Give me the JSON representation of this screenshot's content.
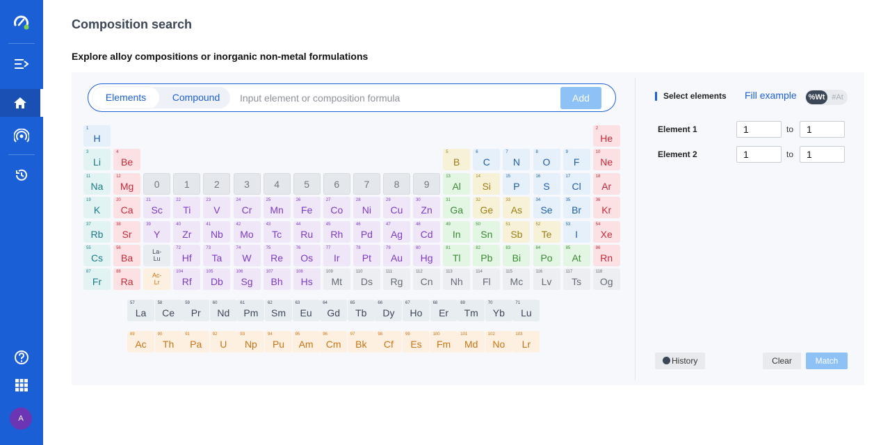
{
  "sidebar": {
    "items": [
      {
        "name": "logo",
        "icon": "speedometer-logo-icon"
      },
      {
        "name": "collapse-menu",
        "icon": "collapse-menu-icon"
      },
      {
        "name": "home",
        "icon": "home-icon",
        "active": true
      },
      {
        "name": "broadcast",
        "icon": "broadcast-icon"
      },
      {
        "name": "history",
        "icon": "history-clock-icon"
      },
      {
        "name": "help",
        "icon": "help-icon"
      },
      {
        "name": "apps",
        "icon": "apps-grid-icon"
      }
    ],
    "avatar": "A"
  },
  "page": {
    "title": "Composition search",
    "subtitle": "Explore alloy compositions or inorganic non-metal formulations"
  },
  "search": {
    "mode_elements": "Elements",
    "mode_compound": "Compound",
    "placeholder": "Input element or composition formula",
    "add_label": "Add"
  },
  "periodic_table": {
    "group_colors": {
      "nonmetal": {
        "bg": "#e6f0fa",
        "fg": "#1b5fa8"
      },
      "noble": {
        "bg": "#fbe1e3",
        "fg": "#c4293a"
      },
      "alkali": {
        "bg": "#e1f3f3",
        "fg": "#1c7a85"
      },
      "alkaline": {
        "bg": "#fbe1e3",
        "fg": "#c4293a"
      },
      "transition": {
        "bg": "#efe6f8",
        "fg": "#7b3bc2"
      },
      "post": {
        "bg": "#e3f5e3",
        "fg": "#3a8a34"
      },
      "metalloid": {
        "bg": "#f7f1d8",
        "fg": "#9b7d13"
      },
      "unknown": {
        "bg": "#eceef1",
        "fg": "#646a75"
      },
      "lanthanide": {
        "bg": "#e8edf2",
        "fg": "#3b4656"
      },
      "actinide": {
        "bg": "#fdf0e0",
        "fg": "#c97416"
      }
    },
    "elements": [
      {
        "n": "1",
        "s": "H",
        "r": 1,
        "c": 1,
        "g": "nonmetal"
      },
      {
        "n": "2",
        "s": "He",
        "r": 1,
        "c": 18,
        "g": "noble"
      },
      {
        "n": "3",
        "s": "Li",
        "r": 2,
        "c": 1,
        "g": "alkali"
      },
      {
        "n": "4",
        "s": "Be",
        "r": 2,
        "c": 2,
        "g": "alkaline"
      },
      {
        "n": "5",
        "s": "B",
        "r": 2,
        "c": 13,
        "g": "metalloid"
      },
      {
        "n": "6",
        "s": "C",
        "r": 2,
        "c": 14,
        "g": "nonmetal"
      },
      {
        "n": "7",
        "s": "N",
        "r": 2,
        "c": 15,
        "g": "nonmetal"
      },
      {
        "n": "8",
        "s": "O",
        "r": 2,
        "c": 16,
        "g": "nonmetal"
      },
      {
        "n": "9",
        "s": "F",
        "r": 2,
        "c": 17,
        "g": "nonmetal"
      },
      {
        "n": "10",
        "s": "Ne",
        "r": 2,
        "c": 18,
        "g": "noble"
      },
      {
        "n": "11",
        "s": "Na",
        "r": 3,
        "c": 1,
        "g": "alkali"
      },
      {
        "n": "12",
        "s": "Mg",
        "r": 3,
        "c": 2,
        "g": "alkaline"
      },
      {
        "n": "13",
        "s": "Al",
        "r": 3,
        "c": 13,
        "g": "post"
      },
      {
        "n": "14",
        "s": "Si",
        "r": 3,
        "c": 14,
        "g": "metalloid"
      },
      {
        "n": "15",
        "s": "P",
        "r": 3,
        "c": 15,
        "g": "nonmetal"
      },
      {
        "n": "16",
        "s": "S",
        "r": 3,
        "c": 16,
        "g": "nonmetal"
      },
      {
        "n": "17",
        "s": "Cl",
        "r": 3,
        "c": 17,
        "g": "nonmetal"
      },
      {
        "n": "18",
        "s": "Ar",
        "r": 3,
        "c": 18,
        "g": "noble"
      },
      {
        "n": "19",
        "s": "K",
        "r": 4,
        "c": 1,
        "g": "alkali"
      },
      {
        "n": "20",
        "s": "Ca",
        "r": 4,
        "c": 2,
        "g": "alkaline"
      },
      {
        "n": "21",
        "s": "Sc",
        "r": 4,
        "c": 3,
        "g": "transition"
      },
      {
        "n": "22",
        "s": "Ti",
        "r": 4,
        "c": 4,
        "g": "transition"
      },
      {
        "n": "23",
        "s": "V",
        "r": 4,
        "c": 5,
        "g": "transition"
      },
      {
        "n": "24",
        "s": "Cr",
        "r": 4,
        "c": 6,
        "g": "transition"
      },
      {
        "n": "25",
        "s": "Mn",
        "r": 4,
        "c": 7,
        "g": "transition"
      },
      {
        "n": "26",
        "s": "Fe",
        "r": 4,
        "c": 8,
        "g": "transition"
      },
      {
        "n": "27",
        "s": "Co",
        "r": 4,
        "c": 9,
        "g": "transition"
      },
      {
        "n": "28",
        "s": "Ni",
        "r": 4,
        "c": 10,
        "g": "transition"
      },
      {
        "n": "29",
        "s": "Cu",
        "r": 4,
        "c": 11,
        "g": "transition"
      },
      {
        "n": "30",
        "s": "Zn",
        "r": 4,
        "c": 12,
        "g": "transition"
      },
      {
        "n": "31",
        "s": "Ga",
        "r": 4,
        "c": 13,
        "g": "post"
      },
      {
        "n": "32",
        "s": "Ge",
        "r": 4,
        "c": 14,
        "g": "metalloid"
      },
      {
        "n": "33",
        "s": "As",
        "r": 4,
        "c": 15,
        "g": "metalloid"
      },
      {
        "n": "34",
        "s": "Se",
        "r": 4,
        "c": 16,
        "g": "nonmetal"
      },
      {
        "n": "35",
        "s": "Br",
        "r": 4,
        "c": 17,
        "g": "nonmetal"
      },
      {
        "n": "36",
        "s": "Kr",
        "r": 4,
        "c": 18,
        "g": "noble"
      },
      {
        "n": "37",
        "s": "Rb",
        "r": 5,
        "c": 1,
        "g": "alkali"
      },
      {
        "n": "38",
        "s": "Sr",
        "r": 5,
        "c": 2,
        "g": "alkaline"
      },
      {
        "n": "39",
        "s": "Y",
        "r": 5,
        "c": 3,
        "g": "transition"
      },
      {
        "n": "40",
        "s": "Zr",
        "r": 5,
        "c": 4,
        "g": "transition"
      },
      {
        "n": "41",
        "s": "Nb",
        "r": 5,
        "c": 5,
        "g": "transition"
      },
      {
        "n": "42",
        "s": "Mo",
        "r": 5,
        "c": 6,
        "g": "transition"
      },
      {
        "n": "43",
        "s": "Tc",
        "r": 5,
        "c": 7,
        "g": "transition"
      },
      {
        "n": "44",
        "s": "Ru",
        "r": 5,
        "c": 8,
        "g": "transition"
      },
      {
        "n": "45",
        "s": "Rh",
        "r": 5,
        "c": 9,
        "g": "transition"
      },
      {
        "n": "46",
        "s": "Pd",
        "r": 5,
        "c": 10,
        "g": "transition"
      },
      {
        "n": "47",
        "s": "Ag",
        "r": 5,
        "c": 11,
        "g": "transition"
      },
      {
        "n": "48",
        "s": "Cd",
        "r": 5,
        "c": 12,
        "g": "transition"
      },
      {
        "n": "49",
        "s": "In",
        "r": 5,
        "c": 13,
        "g": "post"
      },
      {
        "n": "50",
        "s": "Sn",
        "r": 5,
        "c": 14,
        "g": "post"
      },
      {
        "n": "51",
        "s": "Sb",
        "r": 5,
        "c": 15,
        "g": "metalloid"
      },
      {
        "n": "52",
        "s": "Te",
        "r": 5,
        "c": 16,
        "g": "metalloid"
      },
      {
        "n": "53",
        "s": "I",
        "r": 5,
        "c": 17,
        "g": "nonmetal"
      },
      {
        "n": "54",
        "s": "Xe",
        "r": 5,
        "c": 18,
        "g": "noble"
      },
      {
        "n": "55",
        "s": "Cs",
        "r": 6,
        "c": 1,
        "g": "alkali"
      },
      {
        "n": "56",
        "s": "Ba",
        "r": 6,
        "c": 2,
        "g": "alkaline"
      },
      {
        "n": "",
        "s": "La-\nLu",
        "r": 6,
        "c": 3,
        "g": "lanthanide",
        "small": true
      },
      {
        "n": "72",
        "s": "Hf",
        "r": 6,
        "c": 4,
        "g": "transition"
      },
      {
        "n": "73",
        "s": "Ta",
        "r": 6,
        "c": 5,
        "g": "transition"
      },
      {
        "n": "74",
        "s": "W",
        "r": 6,
        "c": 6,
        "g": "transition"
      },
      {
        "n": "75",
        "s": "Re",
        "r": 6,
        "c": 7,
        "g": "transition"
      },
      {
        "n": "76",
        "s": "Os",
        "r": 6,
        "c": 8,
        "g": "transition"
      },
      {
        "n": "77",
        "s": "Ir",
        "r": 6,
        "c": 9,
        "g": "transition"
      },
      {
        "n": "78",
        "s": "Pt",
        "r": 6,
        "c": 10,
        "g": "transition"
      },
      {
        "n": "79",
        "s": "Au",
        "r": 6,
        "c": 11,
        "g": "transition"
      },
      {
        "n": "80",
        "s": "Hg",
        "r": 6,
        "c": 12,
        "g": "transition"
      },
      {
        "n": "81",
        "s": "Tl",
        "r": 6,
        "c": 13,
        "g": "post"
      },
      {
        "n": "82",
        "s": "Pb",
        "r": 6,
        "c": 14,
        "g": "post"
      },
      {
        "n": "83",
        "s": "Bi",
        "r": 6,
        "c": 15,
        "g": "post"
      },
      {
        "n": "84",
        "s": "Po",
        "r": 6,
        "c": 16,
        "g": "post"
      },
      {
        "n": "85",
        "s": "At",
        "r": 6,
        "c": 17,
        "g": "post"
      },
      {
        "n": "86",
        "s": "Rn",
        "r": 6,
        "c": 18,
        "g": "noble"
      },
      {
        "n": "87",
        "s": "Fr",
        "r": 7,
        "c": 1,
        "g": "alkali"
      },
      {
        "n": "88",
        "s": "Ra",
        "r": 7,
        "c": 2,
        "g": "alkaline"
      },
      {
        "n": "",
        "s": "Ac-\nLr",
        "r": 7,
        "c": 3,
        "g": "actinide",
        "small": true
      },
      {
        "n": "104",
        "s": "Rf",
        "r": 7,
        "c": 4,
        "g": "transition"
      },
      {
        "n": "105",
        "s": "Db",
        "r": 7,
        "c": 5,
        "g": "transition"
      },
      {
        "n": "106",
        "s": "Sg",
        "r": 7,
        "c": 6,
        "g": "transition"
      },
      {
        "n": "107",
        "s": "Bh",
        "r": 7,
        "c": 7,
        "g": "transition"
      },
      {
        "n": "108",
        "s": "Hs",
        "r": 7,
        "c": 8,
        "g": "transition"
      },
      {
        "n": "109",
        "s": "Mt",
        "r": 7,
        "c": 9,
        "g": "unknown"
      },
      {
        "n": "110",
        "s": "Ds",
        "r": 7,
        "c": 10,
        "g": "unknown"
      },
      {
        "n": "111",
        "s": "Rg",
        "r": 7,
        "c": 11,
        "g": "unknown"
      },
      {
        "n": "112",
        "s": "Cn",
        "r": 7,
        "c": 12,
        "g": "unknown"
      },
      {
        "n": "113",
        "s": "Nh",
        "r": 7,
        "c": 13,
        "g": "unknown"
      },
      {
        "n": "114",
        "s": "Fl",
        "r": 7,
        "c": 14,
        "g": "unknown"
      },
      {
        "n": "115",
        "s": "Mc",
        "r": 7,
        "c": 15,
        "g": "unknown"
      },
      {
        "n": "116",
        "s": "Lv",
        "r": 7,
        "c": 16,
        "g": "unknown"
      },
      {
        "n": "117",
        "s": "Ts",
        "r": 7,
        "c": 17,
        "g": "unknown"
      },
      {
        "n": "118",
        "s": "Og",
        "r": 7,
        "c": 18,
        "g": "unknown"
      }
    ],
    "digits": [
      "0",
      "1",
      "2",
      "3",
      "4",
      "5",
      "6",
      "7",
      "8",
      "9"
    ],
    "lanthanides": [
      {
        "n": "57",
        "s": "La"
      },
      {
        "n": "58",
        "s": "Ce"
      },
      {
        "n": "59",
        "s": "Pr"
      },
      {
        "n": "60",
        "s": "Nd"
      },
      {
        "n": "61",
        "s": "Pm"
      },
      {
        "n": "62",
        "s": "Sm"
      },
      {
        "n": "63",
        "s": "Eu"
      },
      {
        "n": "64",
        "s": "Gd"
      },
      {
        "n": "65",
        "s": "Tb"
      },
      {
        "n": "66",
        "s": "Dy"
      },
      {
        "n": "67",
        "s": "Ho"
      },
      {
        "n": "68",
        "s": "Er"
      },
      {
        "n": "69",
        "s": "Tm"
      },
      {
        "n": "70",
        "s": "Yb"
      },
      {
        "n": "71",
        "s": "Lu"
      }
    ],
    "actinides": [
      {
        "n": "89",
        "s": "Ac"
      },
      {
        "n": "90",
        "s": "Th"
      },
      {
        "n": "91",
        "s": "Pa"
      },
      {
        "n": "92",
        "s": "U"
      },
      {
        "n": "93",
        "s": "Np"
      },
      {
        "n": "94",
        "s": "Pu"
      },
      {
        "n": "95",
        "s": "Am"
      },
      {
        "n": "96",
        "s": "Cm"
      },
      {
        "n": "97",
        "s": "Bk"
      },
      {
        "n": "98",
        "s": "Cf"
      },
      {
        "n": "99",
        "s": "Es"
      },
      {
        "n": "100",
        "s": "Fm"
      },
      {
        "n": "101",
        "s": "Md"
      },
      {
        "n": "102",
        "s": "No"
      },
      {
        "n": "103",
        "s": "Lr"
      }
    ]
  },
  "selection": {
    "title": "Select elements",
    "fill_example": "Fill example",
    "unit_wt": "%Wt",
    "unit_at": "#At",
    "unit_selected": "%Wt",
    "rows": [
      {
        "label": "Element 1",
        "from": "1",
        "to_label": "to",
        "to": "1"
      },
      {
        "label": "Element 2",
        "from": "1",
        "to_label": "to",
        "to": "1"
      }
    ],
    "history_label": "History",
    "clear_label": "Clear",
    "match_label": "Match"
  },
  "colors": {
    "accent": "#1b5fd6",
    "sidebar": "#1b5fd6",
    "button_disabled": "#8ec1f5"
  }
}
